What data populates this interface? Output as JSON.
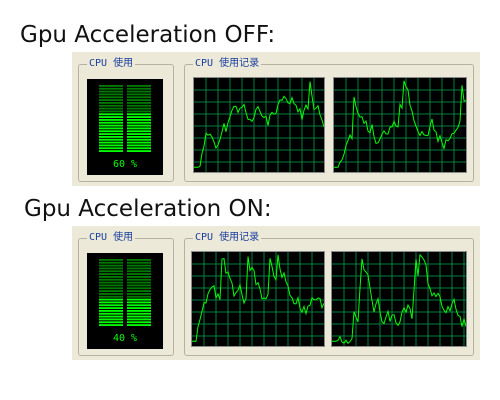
{
  "sections": [
    {
      "title": "Gpu Acceleration OFF:",
      "usage_label": "CPU 使用",
      "history_label": "CPU 使用记录",
      "usage_text": "60 %",
      "usage_fraction": 0.6
    },
    {
      "title": "Gpu Acceleration ON:",
      "usage_label": "CPU 使用",
      "history_label": "CPU 使用记录",
      "usage_text": "40 %",
      "usage_fraction": 0.4
    }
  ],
  "colors": {
    "panel_background": "#ece9d8",
    "graph_background": "#000000",
    "grid": "#008040",
    "line": "#00ff00",
    "meter_off": "#007a00"
  }
}
